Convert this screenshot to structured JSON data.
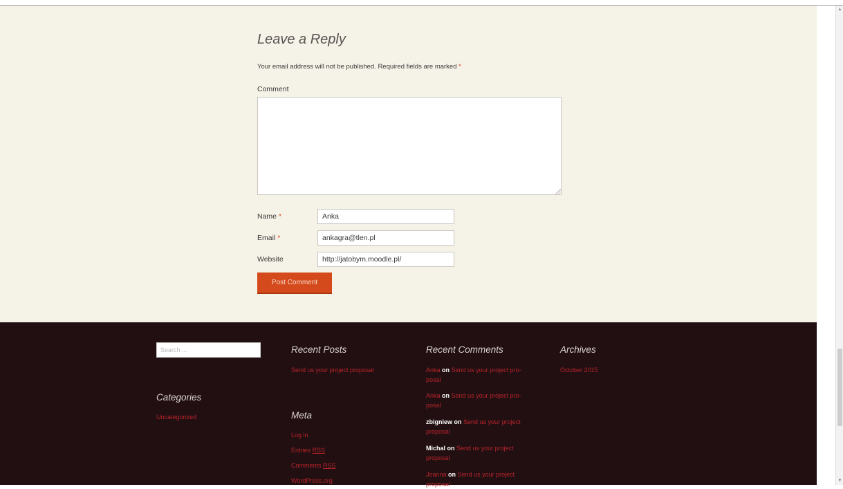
{
  "reply": {
    "title": "Leave a Reply",
    "notes_text": "Your email address will not be published. Required fields are marked",
    "required_mark": "*",
    "comment_label": "Comment",
    "comment_value": "",
    "name_label": "Name",
    "name_value": "Anka",
    "email_label": "Email",
    "email_value": "ankagra@tlen.pl",
    "website_label": "Website",
    "website_value": "http://jatobym.moodle.pl/",
    "submit_label": "Post Comment"
  },
  "footer": {
    "search_placeholder": "Search ...",
    "recent_posts": {
      "title": "Recent Posts",
      "items": [
        "Send us your project proposal"
      ]
    },
    "recent_comments": {
      "title": "Recent Comments",
      "on_word": "on",
      "items": [
        {
          "author": "Anka",
          "post_line1": "Send us your project pro-",
          "post_line2": "posal"
        },
        {
          "author": "Anka",
          "post_line1": "Send us your project pro-",
          "post_line2": "posal"
        },
        {
          "author": "zbigniew",
          "post_line1": "Send us your project",
          "post_line2": "proposal"
        },
        {
          "author": "Michal",
          "post_line1": "Send us your project",
          "post_line2": "proposal"
        },
        {
          "author": "Joanna",
          "post_line1": "Send us your project",
          "post_line2": "proposal"
        }
      ]
    },
    "archives": {
      "title": "Archives",
      "items": [
        "October 2015"
      ]
    },
    "categories": {
      "title": "Categories",
      "items": [
        "Uncategorized"
      ]
    },
    "meta": {
      "title": "Meta",
      "login": "Log in",
      "entries_prefix": "Entries",
      "comments_prefix": "Comments",
      "rss": "RSS",
      "wordpress": "WordPress.org"
    }
  },
  "colors": {
    "content_bg": "#f5f2e7",
    "footer_bg": "#220f12",
    "accent_button": "#d54a1c",
    "link_red": "#b8242b"
  }
}
